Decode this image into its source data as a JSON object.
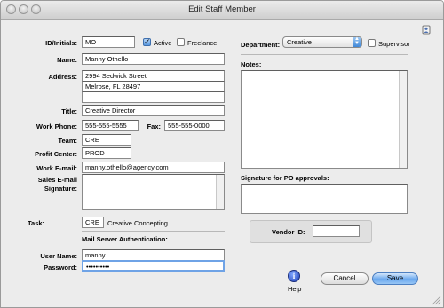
{
  "window": {
    "title": "Edit Staff Member"
  },
  "labels": {
    "id": "ID/Initials:",
    "name": "Name:",
    "address": "Address:",
    "title": "Title:",
    "work_phone": "Work Phone:",
    "fax": "Fax:",
    "team": "Team:",
    "profit_center": "Profit Center:",
    "work_email": "Work E-mail:",
    "sales_sig": "Sales E-mail\nSignature:",
    "task": "Task:",
    "mail_auth": "Mail Server Authentication:",
    "user_name": "User Name:",
    "password": "Password:",
    "department": "Department:",
    "notes": "Notes:",
    "po_sig": "Signature for PO approvals:",
    "vendor_id": "Vendor ID:"
  },
  "fields": {
    "id": "MO",
    "name": "Manny Othello",
    "address_line1": "2994 Sedwick Street",
    "address_line2": "Melrose, FL 28497",
    "address_line3": "",
    "title": "Creative Director",
    "work_phone": "555-555-5555",
    "fax": "555-555-0000",
    "team": "CRE",
    "profit_center": "PROD",
    "work_email": "manny.othello@agency.com",
    "task_code": "CRE",
    "task_name": "Creative Concepting",
    "user_name": "manny",
    "password": "••••••••••",
    "vendor_id": ""
  },
  "checkboxes": {
    "active": {
      "label": "Active",
      "checked": true
    },
    "freelance": {
      "label": "Freelance",
      "checked": false
    },
    "supervisor": {
      "label": "Supervisor",
      "checked": false
    }
  },
  "department": {
    "selected": "Creative"
  },
  "buttons": {
    "help": "Help",
    "cancel": "Cancel",
    "save": "Save"
  }
}
